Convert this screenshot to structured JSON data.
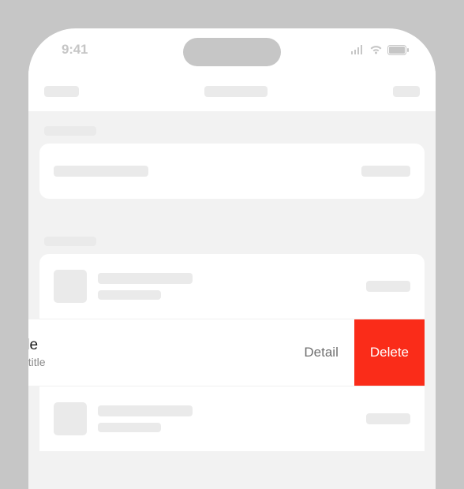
{
  "statusbar": {
    "time": "9:41"
  },
  "swipe_row": {
    "title_fragment": "tle",
    "subtitle_fragment": "btitle",
    "actions": {
      "detail": "Detail",
      "delete": "Delete"
    }
  },
  "colors": {
    "delete": "#fa2c19",
    "placeholder": "#eaeaea",
    "page_bg": "#f2f2f2"
  }
}
